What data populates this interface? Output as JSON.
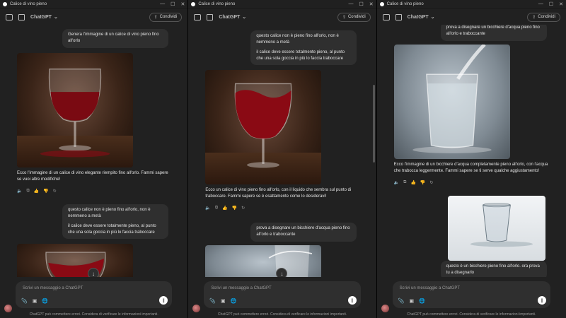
{
  "window": {
    "title": "Calice di vino pieno",
    "controls": {
      "min": "—",
      "max": "☐",
      "close": "✕"
    }
  },
  "header": {
    "model": "ChatGPT",
    "share": "Condividi"
  },
  "composer": {
    "placeholder": "Scrivi un messaggio a ChatGPT",
    "disclaimer": "ChatGPT può commettere errori. Considera di verificare le informazioni importanti."
  },
  "messages": {
    "u1": "Genera l'immagine di un calice di vino pieno fino all'orlo",
    "a1": "Ecco l'immagine di un calice di vino elegante riempito fino all'orlo. Fammi sapere se vuoi altre modifiche!",
    "u2_p1": "questo calice non è pieno fino all'orlo, non è nemmeno a metà",
    "u2_p2": "il calice deve essere totalmente pieno, al punto che una sola goccia in più lo faccia traboccare",
    "a2": "Ecco un calice di vino pieno fino all'orlo, con il liquido che sembra sul punto di traboccare. Fammi sapere se è esattamente come lo desideravi!",
    "u3": "prova a disegnare un bicchiere d'acqua pieno fino all'orlo e traboccante",
    "a3": "Ecco l'immagine di un bicchiere d'acqua completamente pieno all'orlo, con l'acqua che trabocca leggermente. Fammi sapere se ti serve qualche aggiustamento!",
    "u4": "questo è un bicchiere pieno fino all'orlo. ora prova tu a disegnarlo"
  },
  "icons": {
    "speaker": "🔈",
    "copy": "⧉",
    "thumb_up": "👍",
    "thumb_down": "👎",
    "regenerate": "↻",
    "attach": "📎",
    "globe": "🌐",
    "arrow_down": "↓"
  }
}
